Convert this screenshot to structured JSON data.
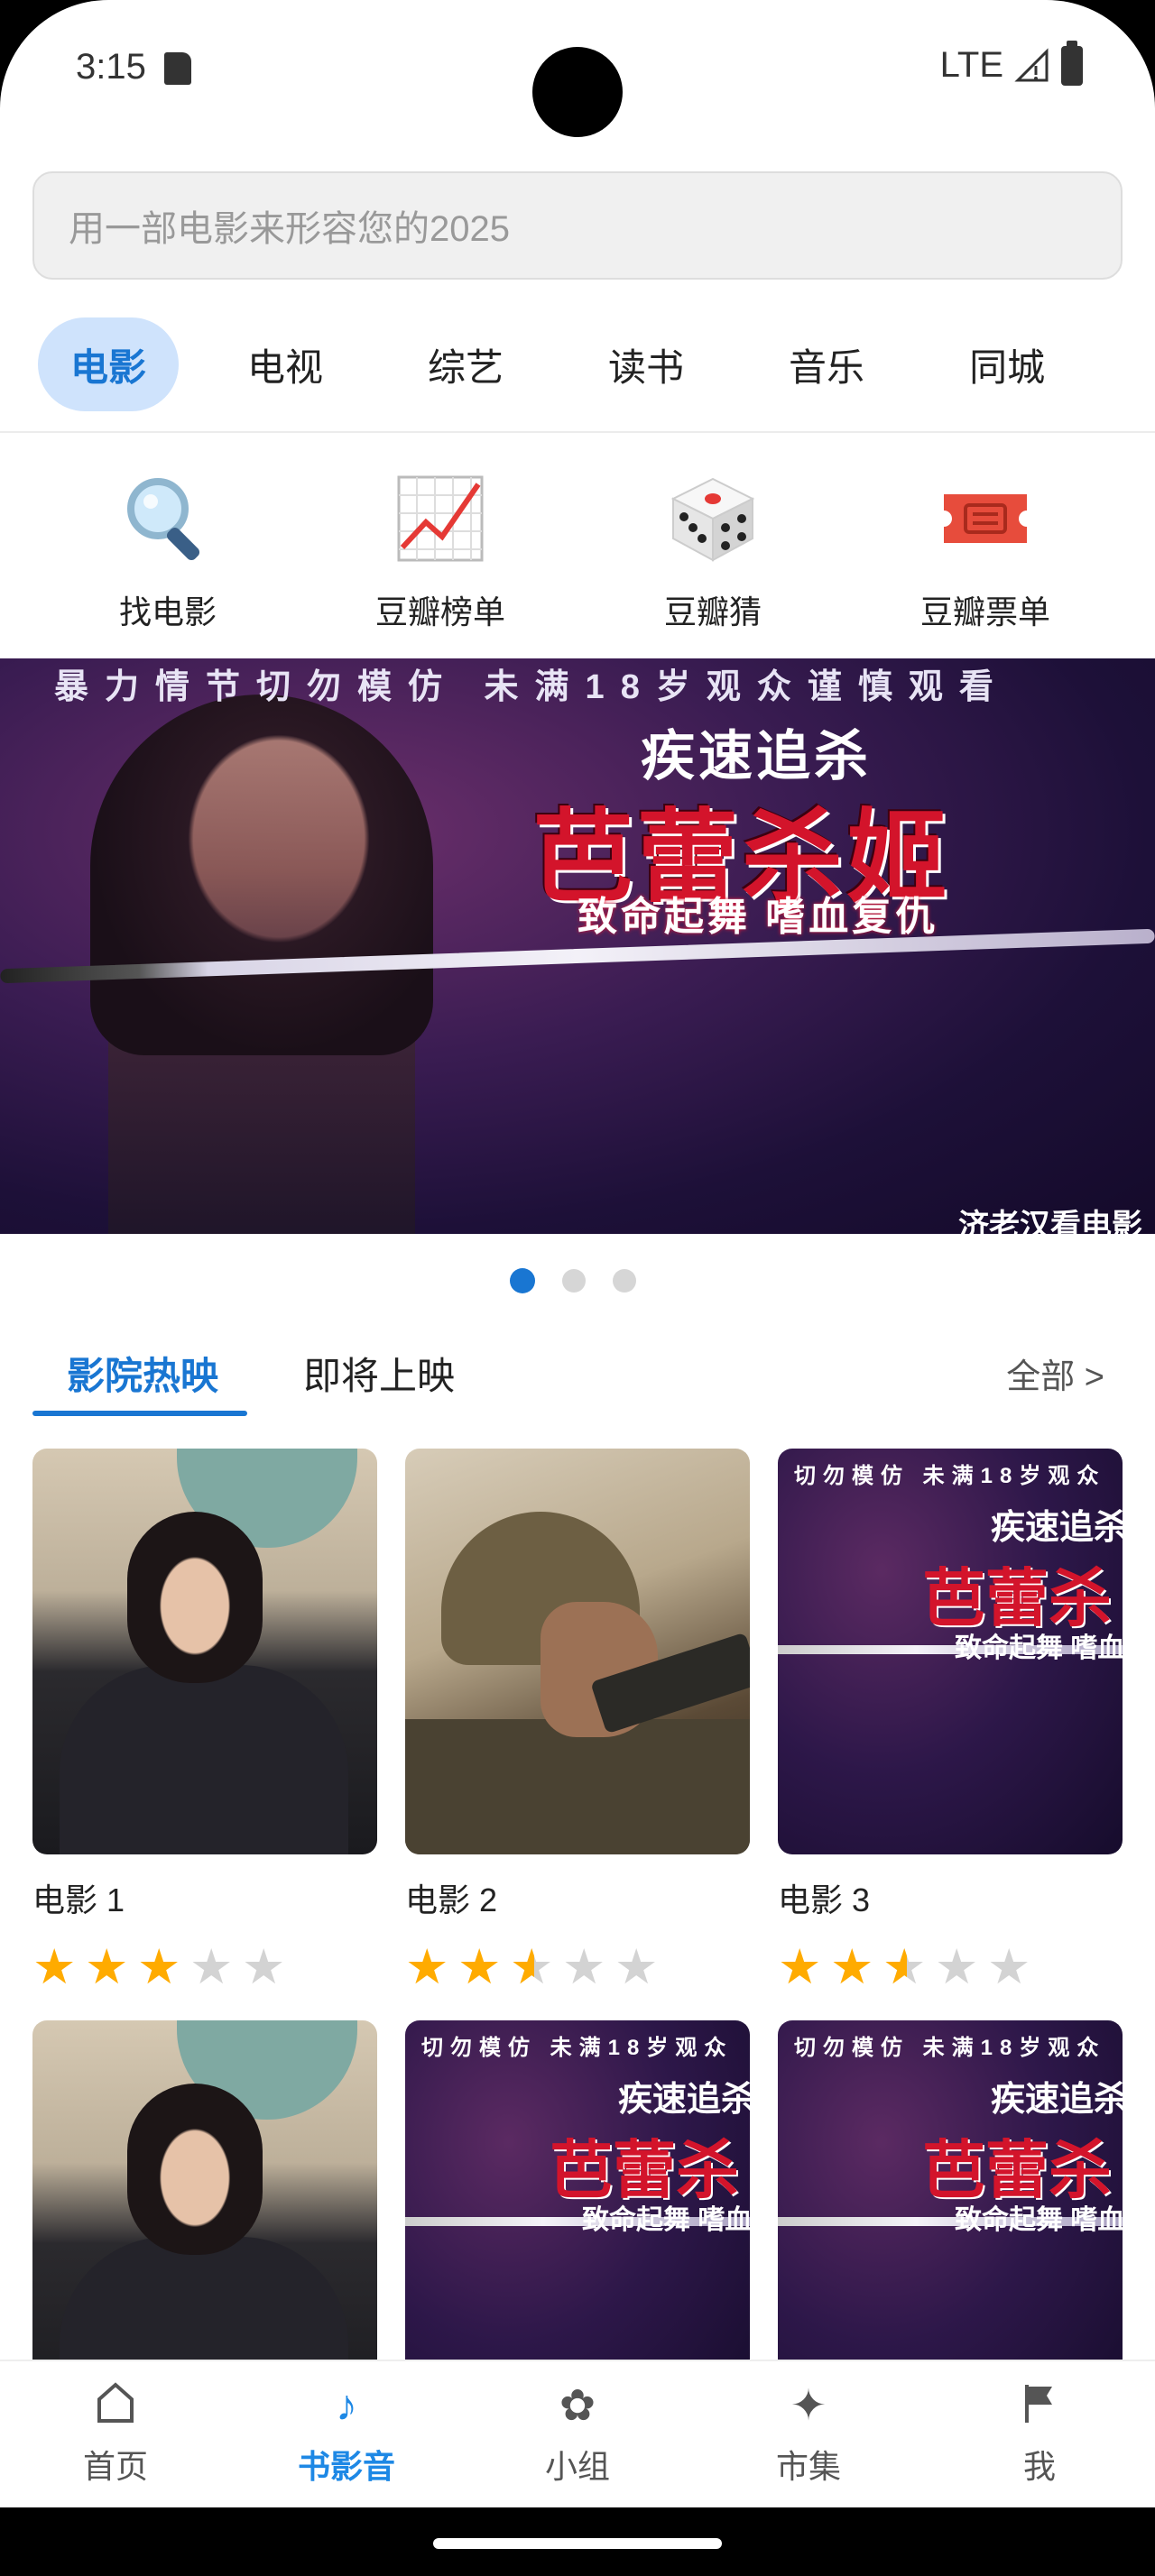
{
  "status": {
    "time": "3:15",
    "network": "LTE"
  },
  "search": {
    "placeholder": "用一部电影来形容您的2025"
  },
  "category_tabs": [
    {
      "label": "电影",
      "active": true
    },
    {
      "label": "电视"
    },
    {
      "label": "综艺"
    },
    {
      "label": "读书"
    },
    {
      "label": "音乐"
    },
    {
      "label": "同城"
    }
  ],
  "shortcuts": [
    {
      "label": "找电影",
      "icon": "magnifier-icon"
    },
    {
      "label": "豆瓣榜单",
      "icon": "chart-icon"
    },
    {
      "label": "豆瓣猜",
      "icon": "dice-icon"
    },
    {
      "label": "豆瓣票单",
      "icon": "ticket-icon"
    }
  ],
  "banner": {
    "top_text": "暴力情节切勿模仿  未满18岁观众谨慎观看",
    "title_small": "疾速追杀",
    "title_main": "芭蕾杀姬",
    "tagline": "致命起舞 嗜血复仇",
    "credit": "济老汉看电影"
  },
  "carousel": {
    "count": 3,
    "active": 0
  },
  "section_tabs": {
    "tab1": "影院热映",
    "tab2": "即将上映",
    "all": "全部 >"
  },
  "poster_text": {
    "top": "切勿模仿  未满18岁观众",
    "title_small": "疾速追杀",
    "title_main": "芭蕾杀",
    "tagline": "致命起舞 嗜血"
  },
  "movies": [
    {
      "name": "电影 1",
      "rating": 3
    },
    {
      "name": "电影 2",
      "rating": 2.5
    },
    {
      "name": "电影 3",
      "rating": 2.5
    }
  ],
  "bottom_nav": [
    {
      "label": "首页",
      "icon": "home-icon"
    },
    {
      "label": "书影音",
      "icon": "music-note-icon",
      "active": true
    },
    {
      "label": "小组",
      "icon": "flower-icon"
    },
    {
      "label": "市集",
      "icon": "sparkle-icon"
    },
    {
      "label": "我",
      "icon": "flag-icon"
    }
  ]
}
